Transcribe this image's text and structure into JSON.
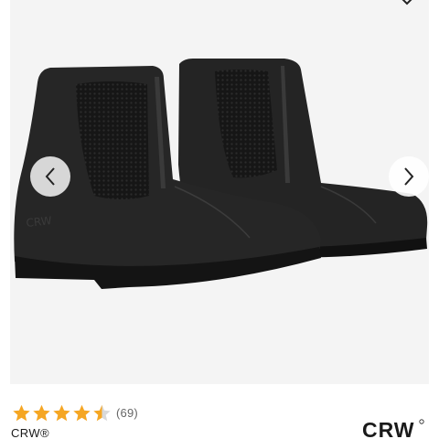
{
  "gallery": {
    "image_alt": "Black leather paddock boots with mesh side panels and front zip",
    "icons": {
      "prev": "chevron-left-icon",
      "next": "chevron-right-icon",
      "top": "chevron-down-icon"
    }
  },
  "product": {
    "rating": 4.5,
    "rating_max": 5,
    "review_count": "(69)",
    "brand": "CRW®",
    "logo_text": "CRW"
  },
  "colors": {
    "star": "#f5a623",
    "boot": "#1f1f1f",
    "background": "#f4f4f4"
  }
}
